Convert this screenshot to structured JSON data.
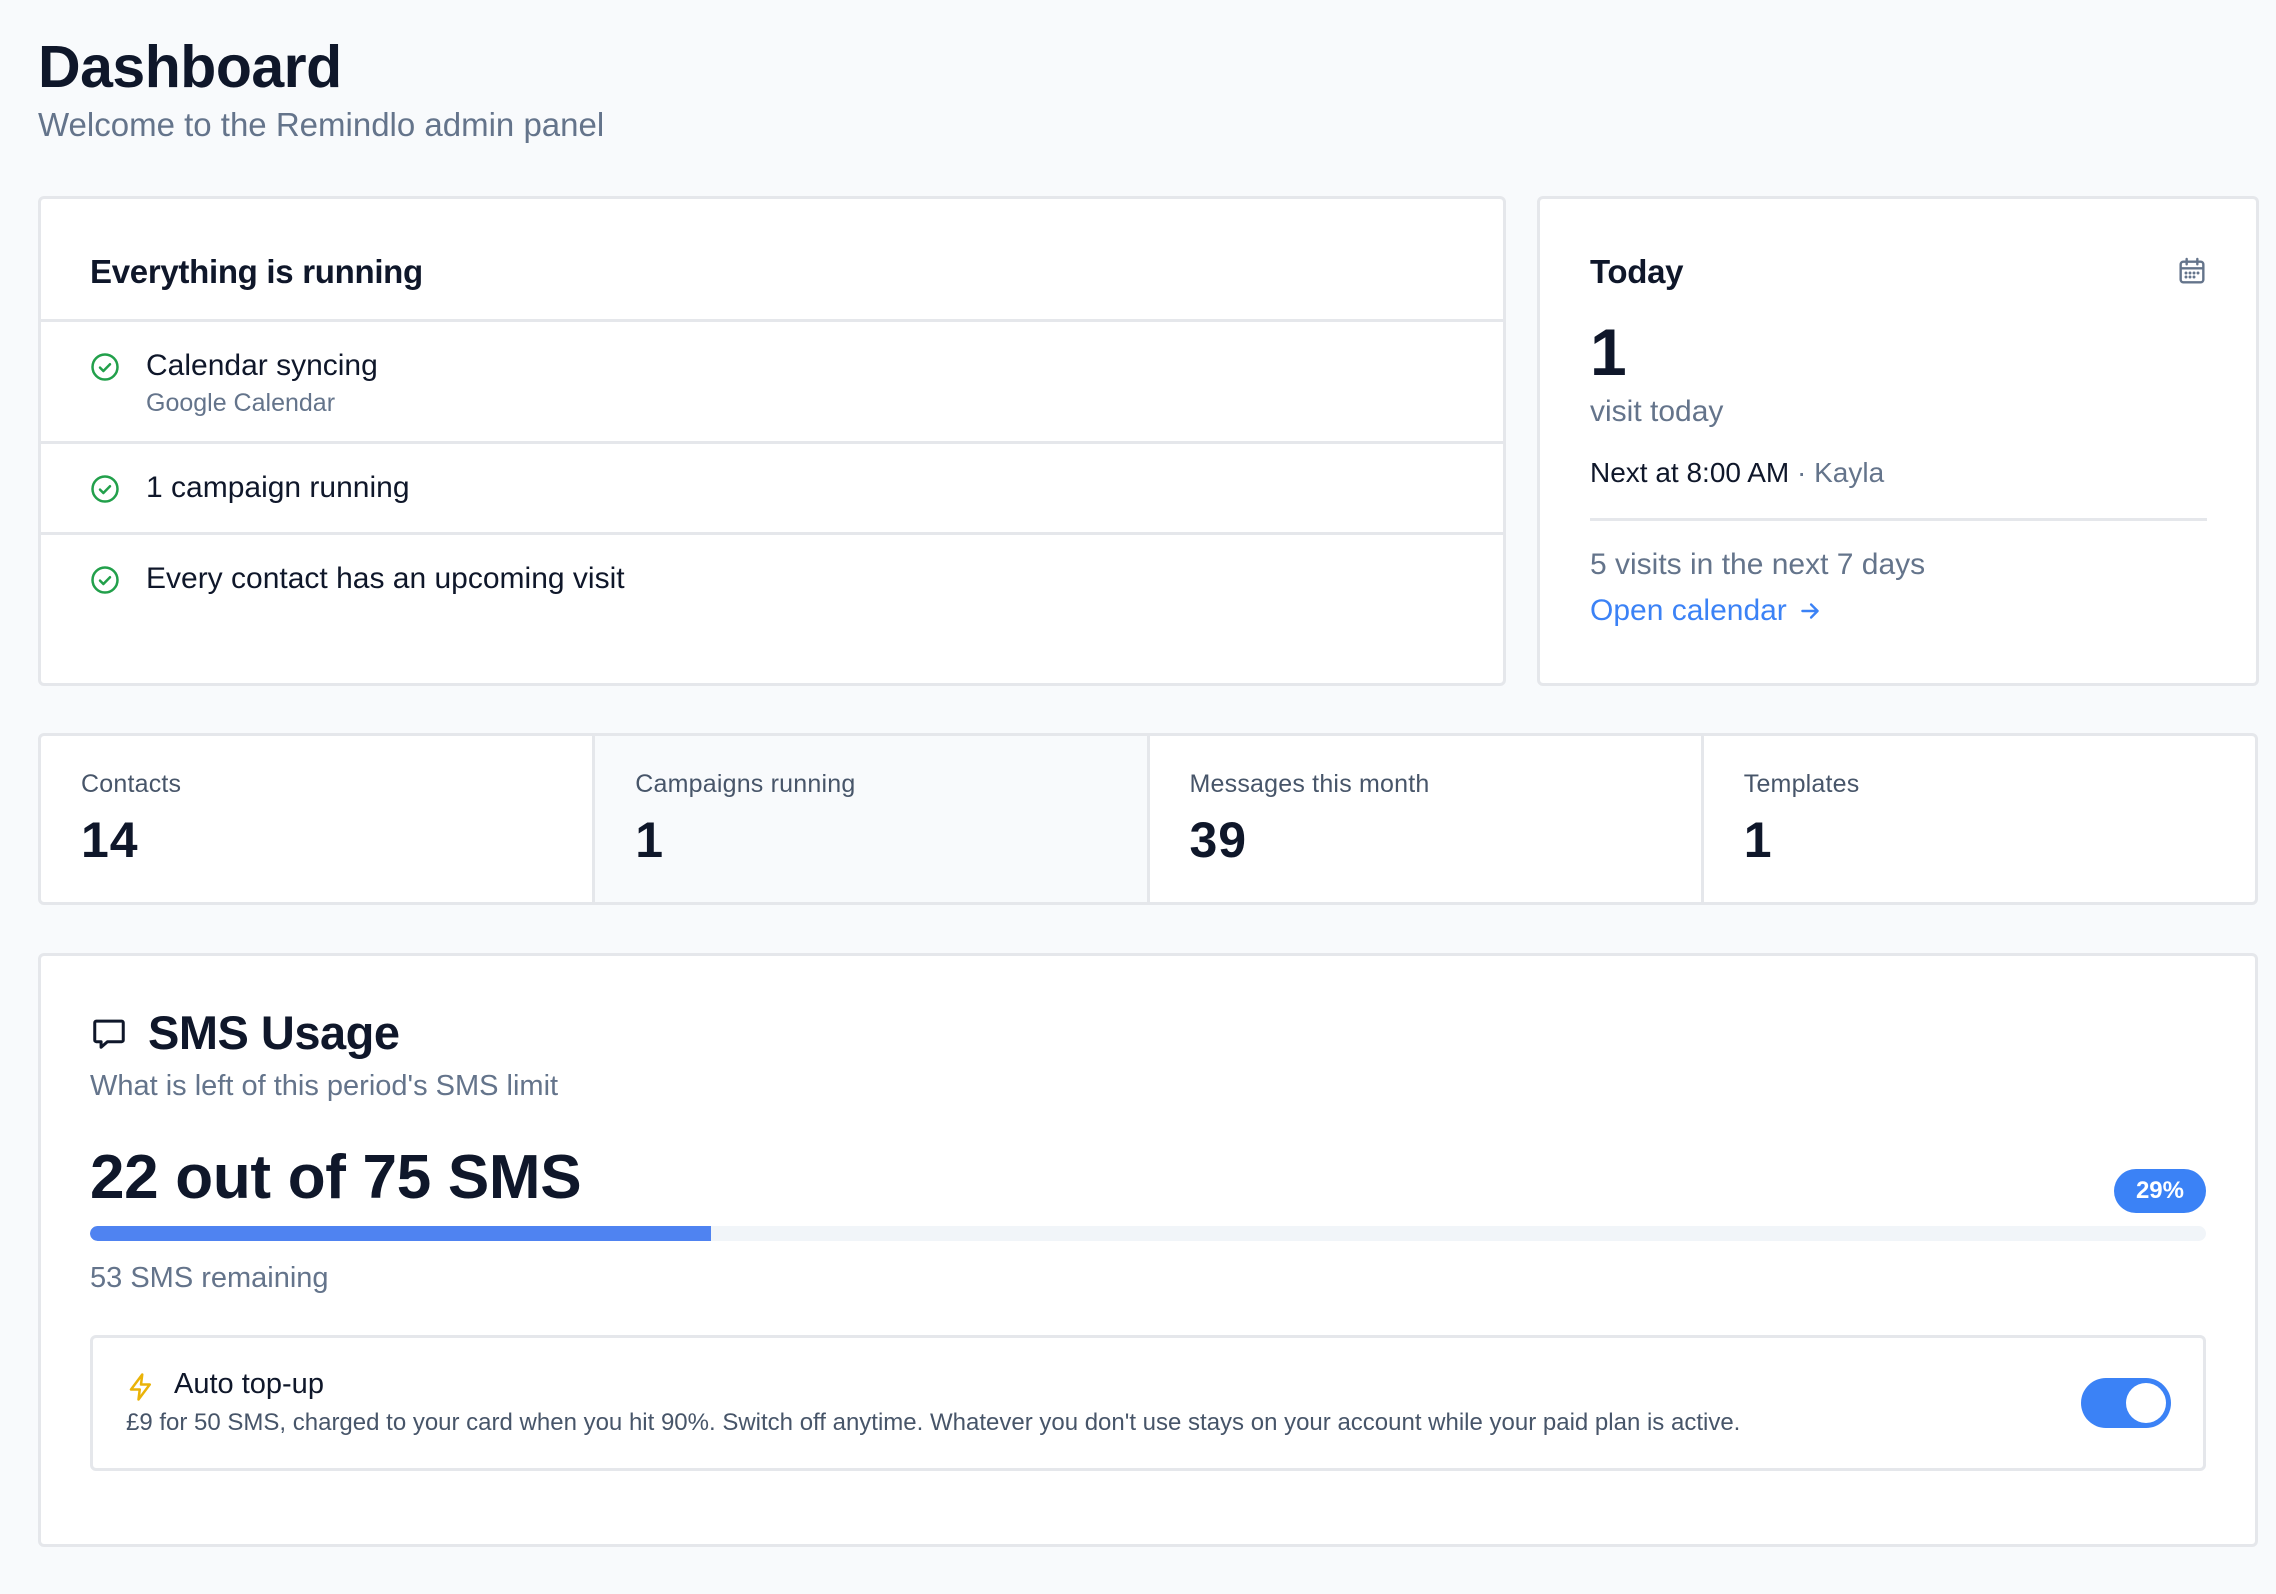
{
  "header": {
    "title": "Dashboard",
    "subtitle": "Welcome to the Remindlo admin panel"
  },
  "status": {
    "title": "Everything is running",
    "items": [
      {
        "title": "Calendar syncing",
        "sub": "Google Calendar",
        "icon": "check-circle-icon"
      },
      {
        "title": "1 campaign running",
        "icon": "check-circle-icon"
      },
      {
        "title": "Every contact has an upcoming visit",
        "icon": "check-circle-icon"
      }
    ],
    "ok_color": "#22a04b"
  },
  "today": {
    "title": "Today",
    "icon": "calendar-icon",
    "count": "1",
    "count_label": "visit today",
    "next_prefix": "Next at",
    "next_time": "8:00 AM",
    "separator": "·",
    "next_name": "Kayla",
    "week_summary": "5 visits in the next 7 days",
    "open_calendar": "Open calendar",
    "link_color": "#3b82f6"
  },
  "stats": [
    {
      "label": "Contacts",
      "value": "14"
    },
    {
      "label": "Campaigns running",
      "value": "1"
    },
    {
      "label": "Messages this month",
      "value": "39"
    },
    {
      "label": "Templates",
      "value": "1"
    }
  ],
  "sms": {
    "icon": "message-square-icon",
    "title": "SMS Usage",
    "subtitle": "What is left of this period's SMS limit",
    "usage": "22 out of 75 SMS",
    "used": 22,
    "limit": 75,
    "percent_label": "29%",
    "remaining": "53 SMS remaining",
    "accent": "#3b82f6",
    "topup": {
      "icon": "lightning-bolt-icon",
      "title": "Auto top-up",
      "description": "£9 for 50 SMS, charged to your card when you hit 90%. Switch off anytime. Whatever you don't use stays on your account while your paid plan is active.",
      "enabled": true
    }
  }
}
